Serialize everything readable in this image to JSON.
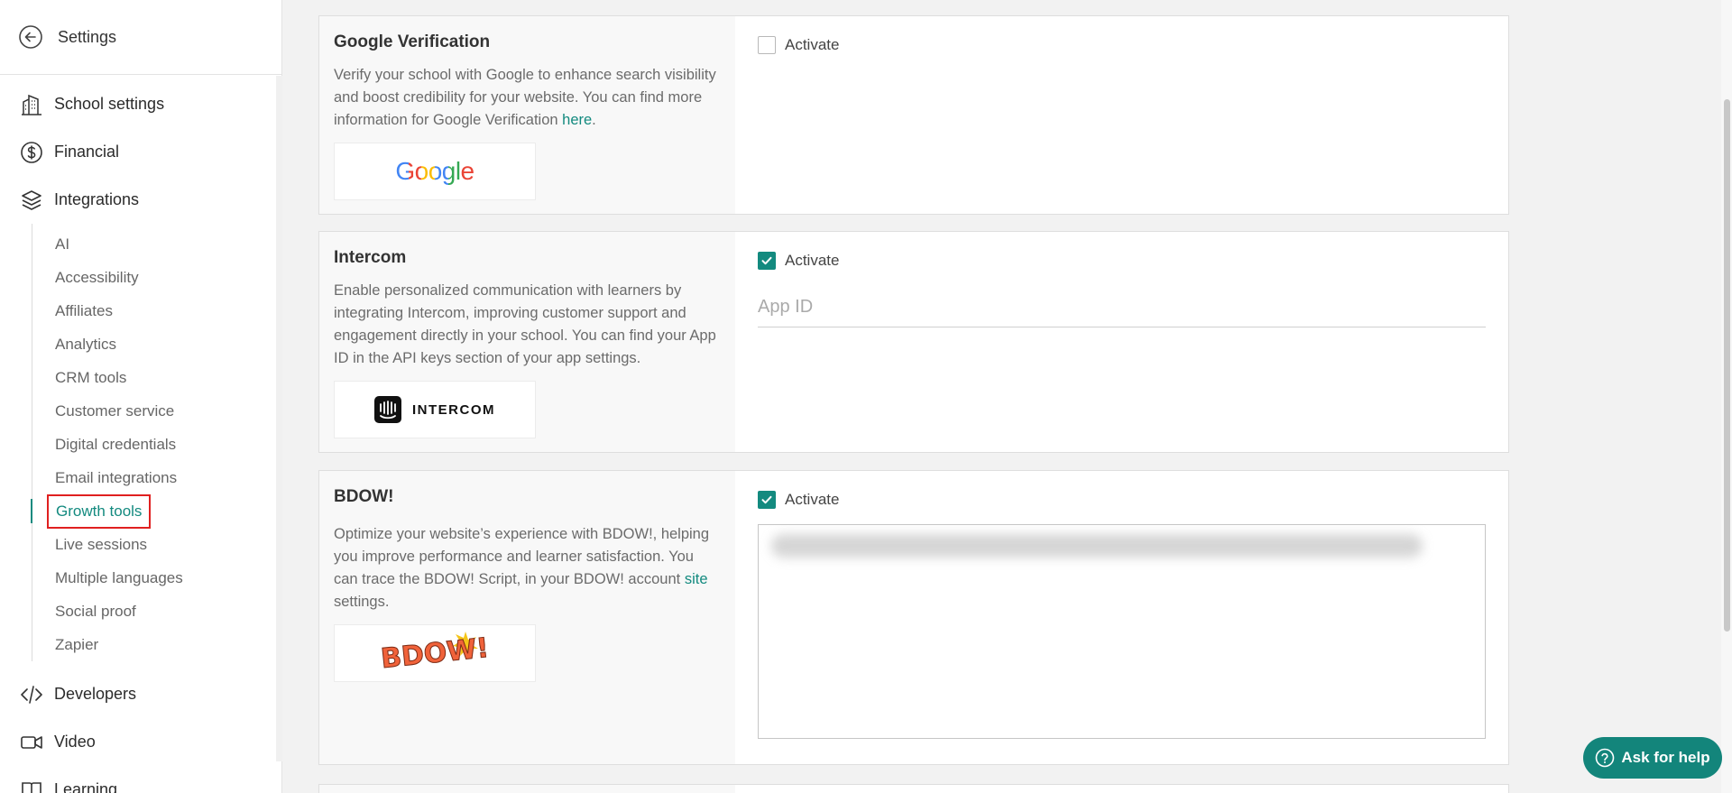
{
  "sidebar": {
    "title": "Settings",
    "top_items": [
      {
        "label": "School settings",
        "icon": "building-icon"
      },
      {
        "label": "Financial",
        "icon": "dollar-circle-icon"
      },
      {
        "label": "Integrations",
        "icon": "layers-icon"
      }
    ],
    "sub_items": [
      "AI",
      "Accessibility",
      "Affiliates",
      "Analytics",
      "CRM tools",
      "Customer service",
      "Digital credentials",
      "Email integrations",
      "Growth tools",
      "Live sessions",
      "Multiple languages",
      "Social proof",
      "Zapier"
    ],
    "active_sub_item": "Growth tools",
    "bottom_items": [
      {
        "label": "Developers",
        "icon": "code-icon"
      },
      {
        "label": "Video",
        "icon": "video-icon"
      },
      {
        "label": "Learning",
        "icon": "book-icon"
      }
    ]
  },
  "cards": {
    "google": {
      "title": "Google Verification",
      "description": "Verify your school with Google to enhance search visibility and boost credibility for your website. You can find more information for Google Verification ",
      "link_text": "here",
      "description_end": ".",
      "logo_text": "Google",
      "activate_label": "Activate",
      "activated": false
    },
    "intercom": {
      "title": "Intercom",
      "description": "Enable personalized communication with learners by integrating Intercom, improving customer support and engagement directly in your school. You can find your App ID in the API keys section of your app settings.",
      "logo_text": "INTERCOM",
      "activate_label": "Activate",
      "activated": true,
      "app_id_placeholder": "App ID"
    },
    "bdow": {
      "title": "BDOW!",
      "description": "Optimize your website’s experience with BDOW!, helping you improve performance and learner satisfaction. You can trace the BDOW! Script, in your BDOW! account ",
      "link_text": "site",
      "description_end": " settings.",
      "logo_text": "BDOW!",
      "activate_label": "Activate",
      "activated": true
    }
  },
  "help_button": {
    "label": "Ask for help",
    "icon": "help-circle-icon"
  },
  "colors": {
    "accent": "#138a7f",
    "highlight_border": "#e02020"
  }
}
